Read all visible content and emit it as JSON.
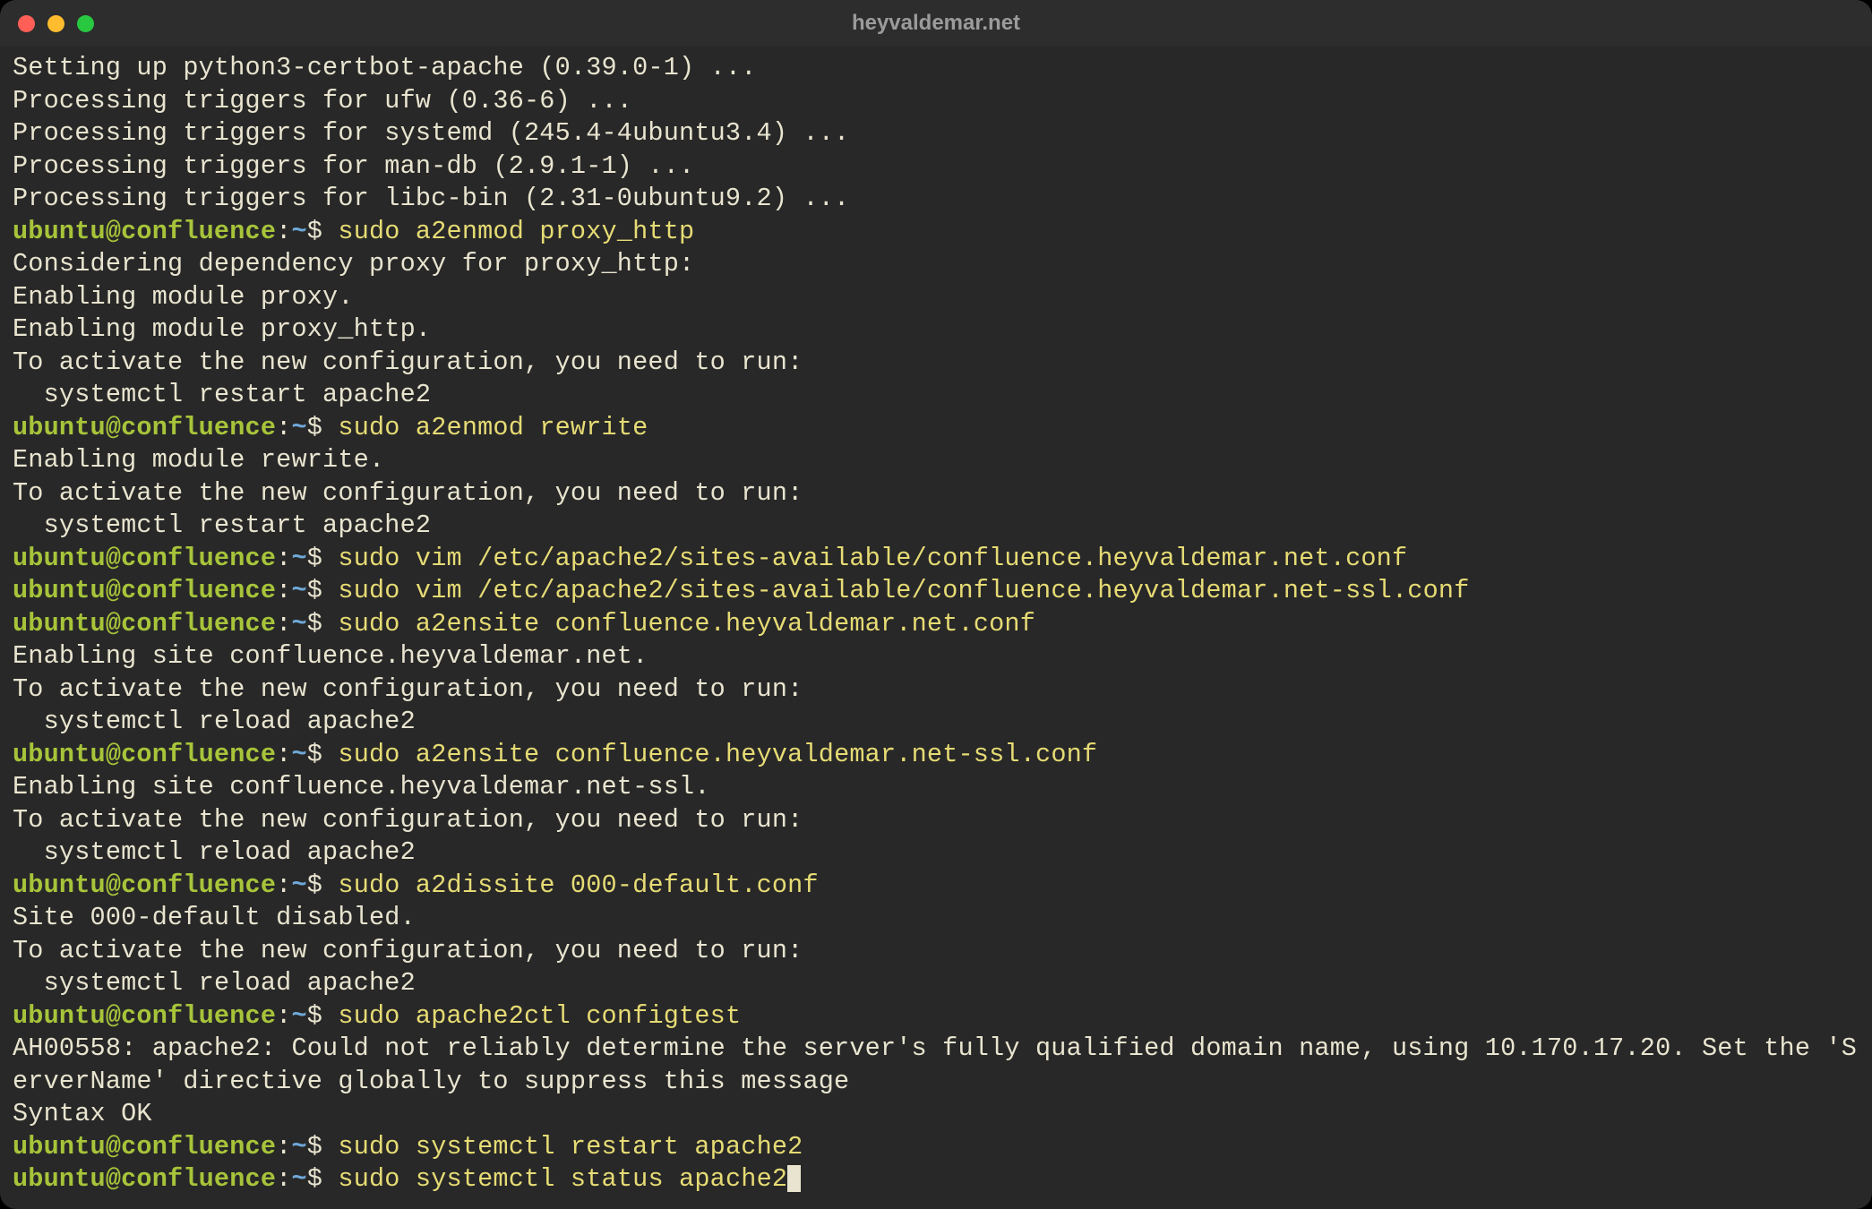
{
  "window": {
    "title": "heyvaldemar.net"
  },
  "prompt": {
    "user": "ubuntu",
    "host": "confluence",
    "sep1": "@",
    "sep2": ":",
    "path": "~",
    "symbol": "$"
  },
  "lines": [
    {
      "t": "out",
      "text": "Setting up python3-certbot-apache (0.39.0-1) ..."
    },
    {
      "t": "out",
      "text": "Processing triggers for ufw (0.36-6) ..."
    },
    {
      "t": "out",
      "text": "Processing triggers for systemd (245.4-4ubuntu3.4) ..."
    },
    {
      "t": "out",
      "text": "Processing triggers for man-db (2.9.1-1) ..."
    },
    {
      "t": "out",
      "text": "Processing triggers for libc-bin (2.31-0ubuntu9.2) ..."
    },
    {
      "t": "cmd",
      "text": "sudo a2enmod proxy_http"
    },
    {
      "t": "out",
      "text": "Considering dependency proxy for proxy_http:"
    },
    {
      "t": "out",
      "text": "Enabling module proxy."
    },
    {
      "t": "out",
      "text": "Enabling module proxy_http."
    },
    {
      "t": "out",
      "text": "To activate the new configuration, you need to run:"
    },
    {
      "t": "out",
      "text": "  systemctl restart apache2"
    },
    {
      "t": "cmd",
      "text": "sudo a2enmod rewrite"
    },
    {
      "t": "out",
      "text": "Enabling module rewrite."
    },
    {
      "t": "out",
      "text": "To activate the new configuration, you need to run:"
    },
    {
      "t": "out",
      "text": "  systemctl restart apache2"
    },
    {
      "t": "cmd",
      "text": "sudo vim /etc/apache2/sites-available/confluence.heyvaldemar.net.conf"
    },
    {
      "t": "cmd",
      "text": "sudo vim /etc/apache2/sites-available/confluence.heyvaldemar.net-ssl.conf"
    },
    {
      "t": "cmd",
      "text": "sudo a2ensite confluence.heyvaldemar.net.conf"
    },
    {
      "t": "out",
      "text": "Enabling site confluence.heyvaldemar.net."
    },
    {
      "t": "out",
      "text": "To activate the new configuration, you need to run:"
    },
    {
      "t": "out",
      "text": "  systemctl reload apache2"
    },
    {
      "t": "cmd",
      "text": "sudo a2ensite confluence.heyvaldemar.net-ssl.conf"
    },
    {
      "t": "out",
      "text": "Enabling site confluence.heyvaldemar.net-ssl."
    },
    {
      "t": "out",
      "text": "To activate the new configuration, you need to run:"
    },
    {
      "t": "out",
      "text": "  systemctl reload apache2"
    },
    {
      "t": "cmd",
      "text": "sudo a2dissite 000-default.conf"
    },
    {
      "t": "out",
      "text": "Site 000-default disabled."
    },
    {
      "t": "out",
      "text": "To activate the new configuration, you need to run:"
    },
    {
      "t": "out",
      "text": "  systemctl reload apache2"
    },
    {
      "t": "cmd",
      "text": "sudo apache2ctl configtest"
    },
    {
      "t": "out",
      "text": "AH00558: apache2: Could not reliably determine the server's fully qualified domain name, using 10.170.17.20. Set the 'ServerName' directive globally to suppress this message"
    },
    {
      "t": "out",
      "text": "Syntax OK"
    },
    {
      "t": "cmd",
      "text": "sudo systemctl restart apache2"
    },
    {
      "t": "cmd",
      "text": "sudo systemctl status apache2",
      "cursor": true
    }
  ]
}
